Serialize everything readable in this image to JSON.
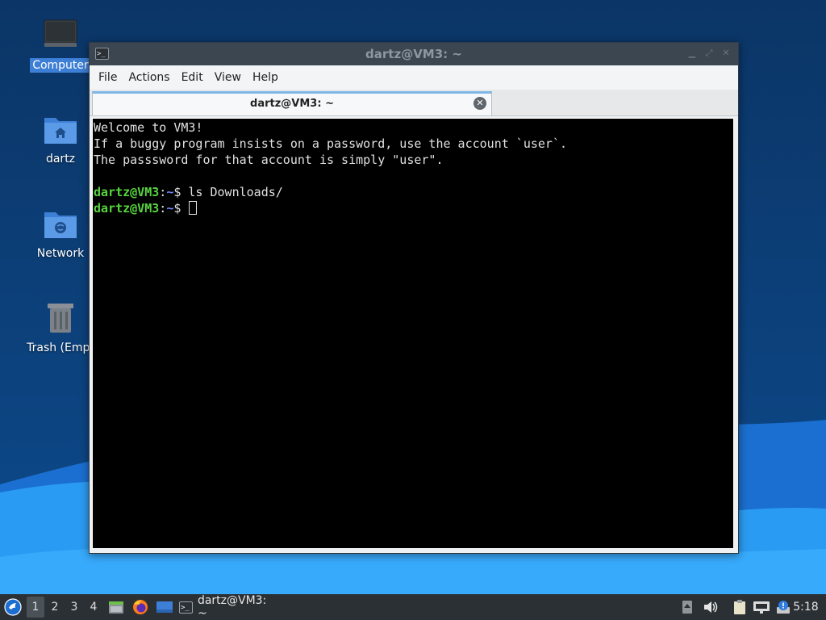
{
  "desktop": {
    "icons": [
      {
        "label": "Computer"
      },
      {
        "label": "dartz"
      },
      {
        "label": "Network"
      },
      {
        "label": "Trash (Empt"
      }
    ]
  },
  "window": {
    "title": "dartz@VM3: ~",
    "menu": [
      "File",
      "Actions",
      "Edit",
      "View",
      "Help"
    ],
    "tab_title": "dartz@VM3: ~",
    "terminal": {
      "welcome_lines": [
        "Welcome to VM3!",
        "If a buggy program insists on a password, use the account `user`.",
        "The passsword for that account is simply \"user\"."
      ],
      "prompts": [
        {
          "user_host": "dartz@VM3",
          "sep": ":",
          "path": "~",
          "symbol": "$",
          "command": " ls Downloads/"
        },
        {
          "user_host": "dartz@VM3",
          "sep": ":",
          "path": "~",
          "symbol": "$",
          "command": " "
        }
      ]
    }
  },
  "taskbar": {
    "workspaces": [
      "1",
      "2",
      "3",
      "4"
    ],
    "active_workspace": "1",
    "task_label": "dartz@VM3: ~",
    "clock": "5:18"
  },
  "colors": {
    "desktop_bg": "#0b3d78",
    "wave_light": "#1f8ff0",
    "prompt_user": "#57d33f",
    "prompt_path": "#6f8cff",
    "terminal_bg": "#000000"
  }
}
